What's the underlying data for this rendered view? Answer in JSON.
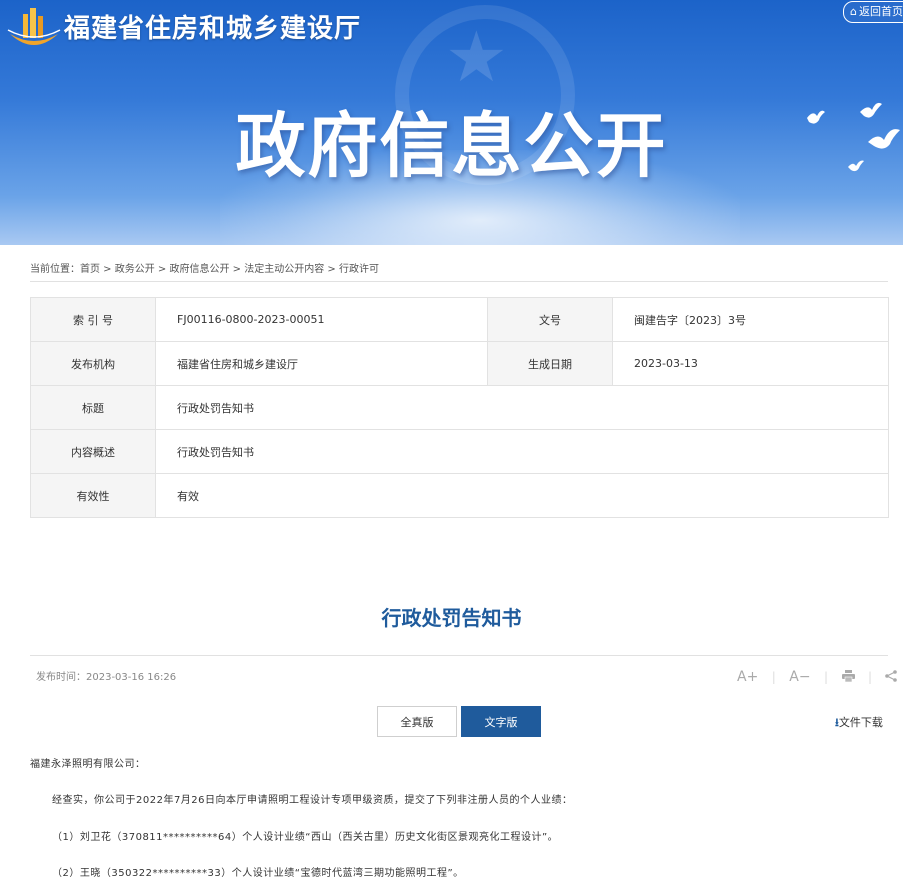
{
  "header": {
    "org_name": "福建省住房和城乡建设厅",
    "home_button": "返回首页",
    "banner_title": "政府信息公开"
  },
  "breadcrumb": "当前位置：首页 > 政务公开 > 政府信息公开 > 法定主动公开内容 > 行政许可",
  "meta": {
    "index_label": "索 引 号",
    "index_value": "FJ00116-0800-2023-00051",
    "docno_label": "文号",
    "docno_value": "闽建告字〔2023〕3号",
    "publisher_label": "发布机构",
    "publisher_value": "福建省住房和城乡建设厅",
    "date_label": "生成日期",
    "date_value": "2023-03-13",
    "title_label": "标题",
    "title_value": "行政处罚告知书",
    "summary_label": "内容概述",
    "summary_value": "行政处罚告知书",
    "validity_label": "有效性",
    "validity_value": "有效"
  },
  "document": {
    "title": "行政处罚告知书",
    "publish_time": "发布时间：2023-03-16 16:26",
    "tab_full": "全真版",
    "tab_text": "文字版",
    "download": "文件下载",
    "tools": {
      "font_up": "A+",
      "font_down": "A−"
    },
    "paragraphs": [
      "福建永泽照明有限公司：",
      "经查实，你公司于2022年7月26日向本厅申请照明工程设计专项甲级资质，提交了下列非注册人员的个人业绩：",
      "（1）刘卫花（370811**********64）个人设计业绩“西山（西关古里）历史文化街区景观亮化工程设计”。",
      "（2）王晓（350322**********33）个人设计业绩“宝德时代蓝湾三期功能照明工程”。"
    ]
  },
  "colors": {
    "accent": "#1f5b9c",
    "banner_top": "#1c63c9",
    "banner_bottom": "#a9c9f2"
  }
}
